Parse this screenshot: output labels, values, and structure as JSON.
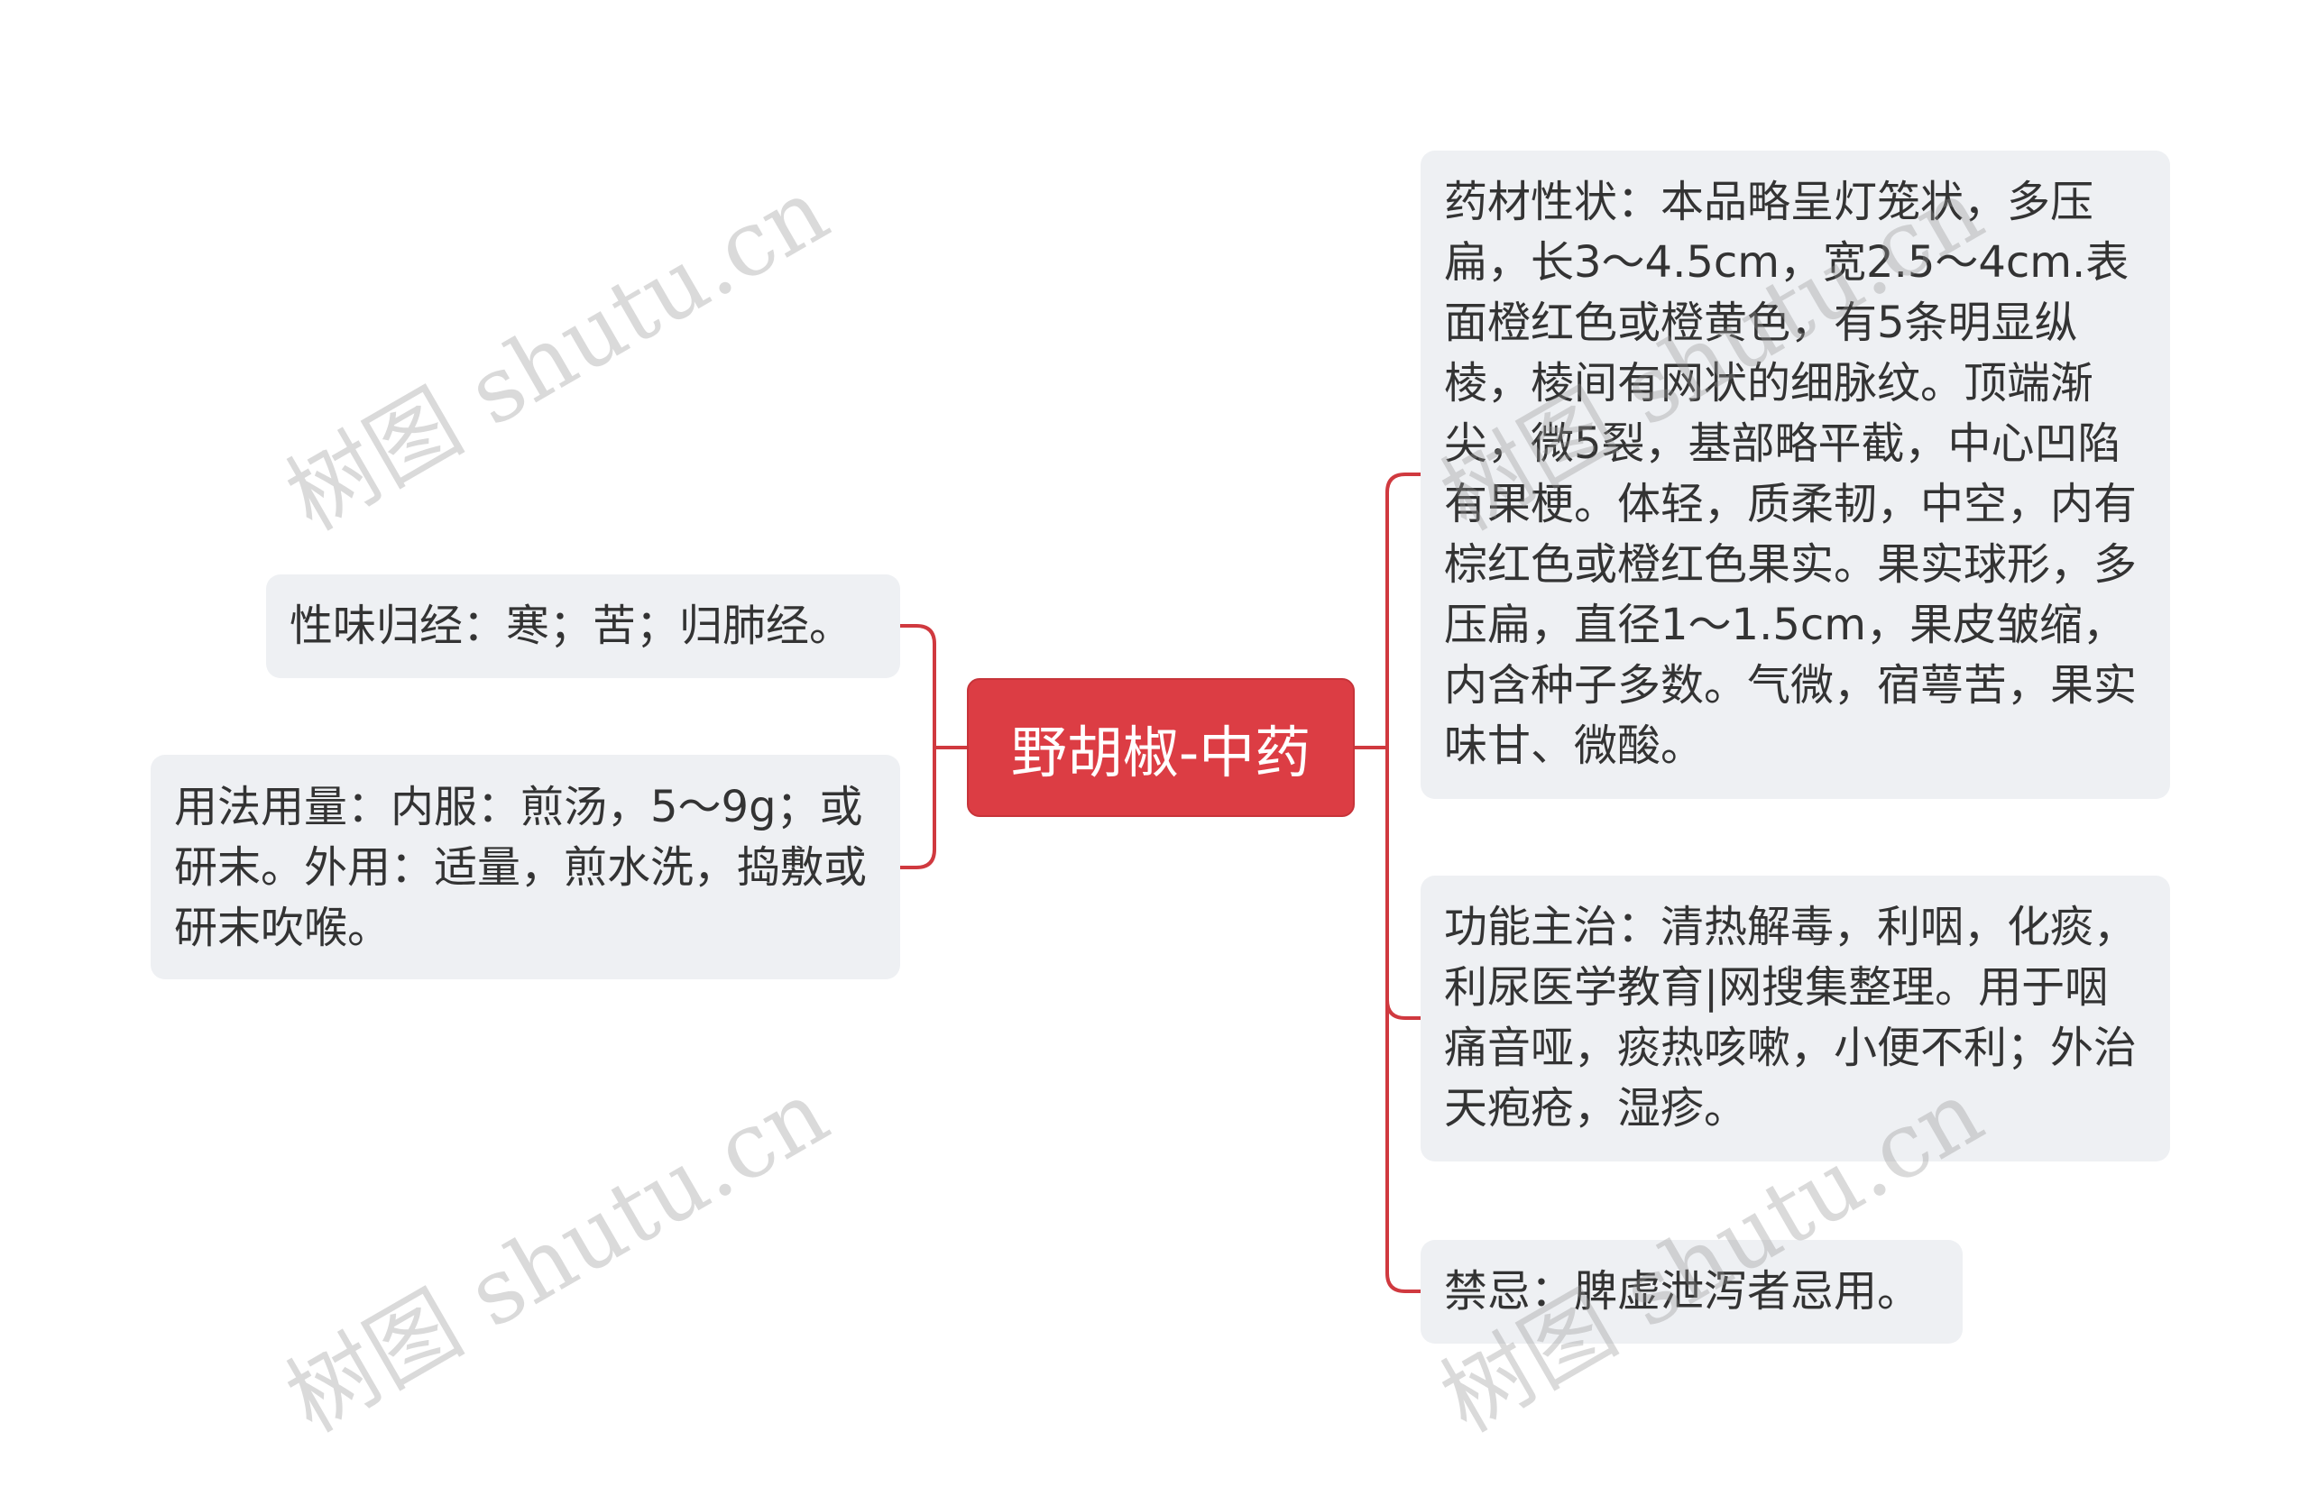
{
  "root": {
    "label": "野胡椒-中药",
    "color": "#dc3d44"
  },
  "left_nodes": [
    {
      "text": "性味归经：寒；苦；归肺经。"
    },
    {
      "text": "用法用量：内服：煎汤，5～9g；或研末。外用：适量，煎水洗，捣敷或研末吹喉。"
    }
  ],
  "right_nodes": [
    {
      "text": "药材性状：本品略呈灯笼状，多压扁，长3～4.5cm，宽2.5～4cm.表面橙红色或橙黄色，有5条明显纵棱，棱间有网状的细脉纹。顶端渐尖，微5裂，基部略平截，中心凹陷有果梗。体轻，质柔韧，中空，内有棕红色或橙红色果实。果实球形，多压扁，直径1～1.5cm，果皮皱缩，内含种子多数。气微，宿萼苦，果实味甘、微酸。"
    },
    {
      "text": "功能主治：清热解毒，利咽，化痰，利尿医学教育|网搜集整理。用于咽痛音哑，痰热咳嗽，小便不利；外治天疱疮，湿疹。"
    },
    {
      "text": "禁忌：脾虚泄泻者忌用。"
    }
  ],
  "watermark": {
    "text": "树图 shutu.cn"
  },
  "link_color": "#d0393f",
  "node_bg": "#eef0f3"
}
